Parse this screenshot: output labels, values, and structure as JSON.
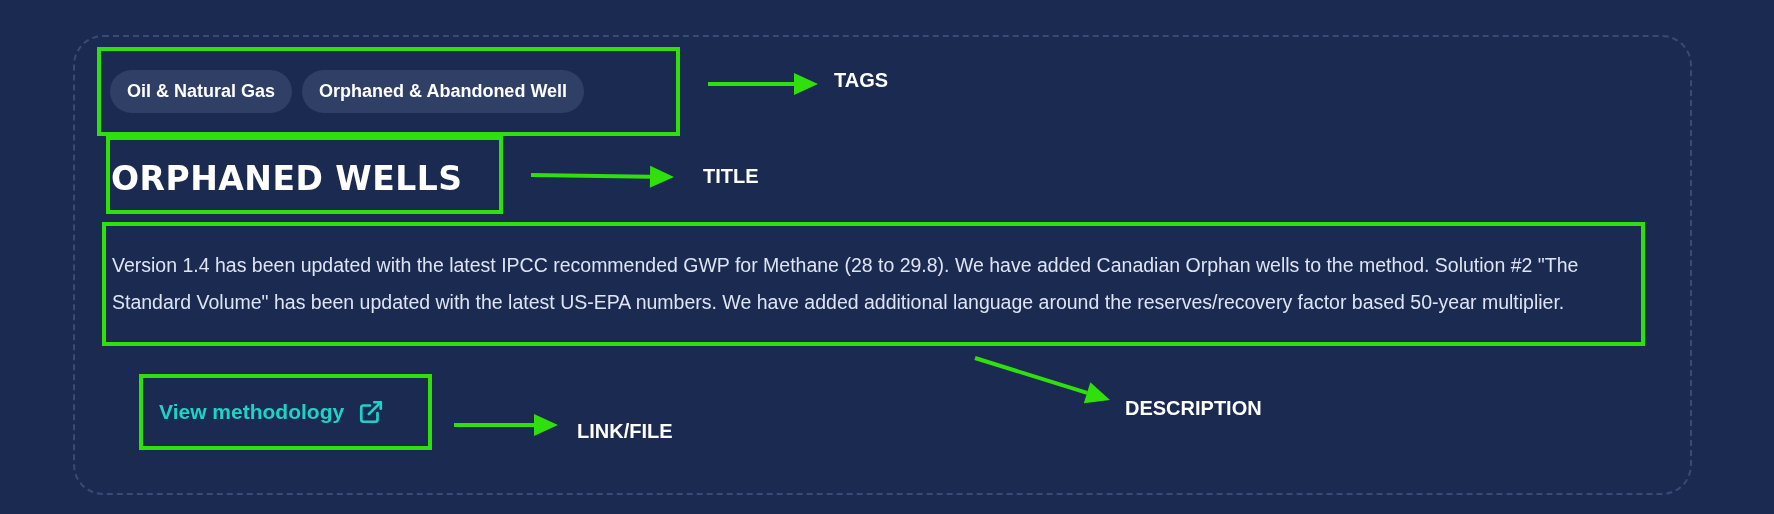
{
  "tags": [
    {
      "label": "Oil & Natural Gas"
    },
    {
      "label": "Orphaned & Abandoned Well"
    }
  ],
  "title": "ORPHANED WELLS",
  "description": "Version 1.4 has been updated with the latest IPCC recommended GWP for Methane (28 to 29.8). We have added Canadian Orphan wells to the method. Solution #2 \"The Standard Volume\" has been updated with the latest US-EPA numbers. We have added additional language around the reserves/recovery factor based 50-year multiplier.",
  "link": {
    "label": "View methodology"
  },
  "annotations": [
    {
      "label": "TAGS"
    },
    {
      "label": "TITLE"
    },
    {
      "label": "DESCRIPTION"
    },
    {
      "label": "LINK/FILE"
    }
  ]
}
